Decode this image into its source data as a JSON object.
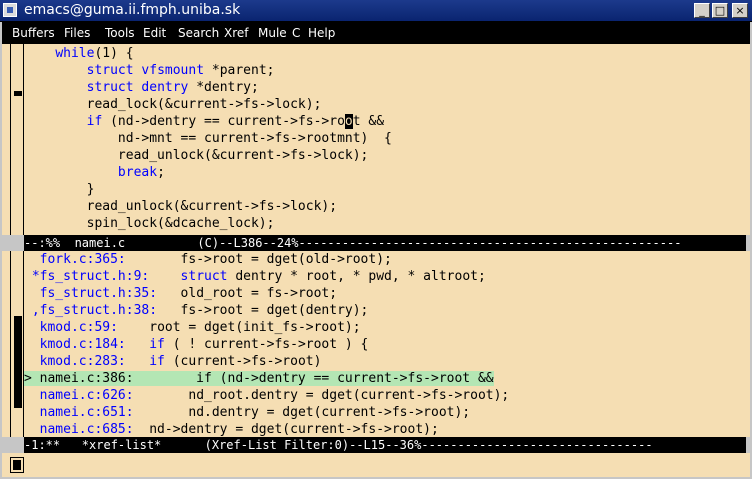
{
  "window": {
    "title": "emacs@guma.ii.fmph.uniba.sk",
    "minimize": "_",
    "maximize": "□",
    "close": "×"
  },
  "menu": [
    "Buffers",
    "Files",
    "Tools",
    "Edit",
    "Search",
    "Xref",
    "Mule",
    "C",
    "Help"
  ],
  "code_lines": [
    [
      {
        "t": "    "
      },
      {
        "t": "while",
        "c": "kw"
      },
      {
        "t": "(1) {"
      }
    ],
    [
      {
        "t": "        "
      },
      {
        "t": "struct",
        "c": "kw"
      },
      {
        "t": " "
      },
      {
        "t": "vfsmount",
        "c": "kw"
      },
      {
        "t": " *parent;"
      }
    ],
    [
      {
        "t": "        "
      },
      {
        "t": "struct",
        "c": "kw"
      },
      {
        "t": " "
      },
      {
        "t": "dentry",
        "c": "kw"
      },
      {
        "t": " *dentry;"
      }
    ],
    [
      {
        "t": "        read_lock(&current->fs->lock);"
      }
    ],
    [
      {
        "t": "        "
      },
      {
        "t": "if",
        "c": "kw"
      },
      {
        "t": " (nd->dentry == current->fs->ro"
      },
      {
        "t": "o",
        "c": "cursor"
      },
      {
        "t": "t &&"
      }
    ],
    [
      {
        "t": "            nd->mnt == current->fs->rootmnt)  {"
      }
    ],
    [
      {
        "t": "            read_unlock(&current->fs->lock);"
      }
    ],
    [
      {
        "t": "            "
      },
      {
        "t": "break",
        "c": "kw"
      },
      {
        "t": ";"
      }
    ],
    [
      {
        "t": "        }"
      }
    ],
    [
      {
        "t": "        read_unlock(&current->fs->lock);"
      }
    ],
    [
      {
        "t": "        spin_lock(&dcache_lock);"
      }
    ]
  ],
  "modeline_top": "--:%%  namei.c          (C)--L386--24%-----------------------------------------------------",
  "xref_lines": [
    [
      {
        "t": "  "
      },
      {
        "t": "fork.c:365:",
        "c": "fn"
      },
      {
        "t": "       fs->root = dget(old->root);"
      }
    ],
    [
      {
        "t": " "
      },
      {
        "t": "*fs_struct.h:9:",
        "c": "fn"
      },
      {
        "t": "    "
      },
      {
        "t": "struct",
        "c": "kw"
      },
      {
        "t": " dentry * root, * pwd, * altroot;"
      }
    ],
    [
      {
        "t": "  "
      },
      {
        "t": "fs_struct.h:35:",
        "c": "fn"
      },
      {
        "t": "   old_root = fs->root;"
      }
    ],
    [
      {
        "t": " "
      },
      {
        "t": ",fs_struct.h:38:",
        "c": "fn"
      },
      {
        "t": "   fs->root = dget(dentry);"
      }
    ],
    [
      {
        "t": "  "
      },
      {
        "t": "kmod.c:59:",
        "c": "fn"
      },
      {
        "t": "    root = dget(init_fs->root);"
      }
    ],
    [
      {
        "t": "  "
      },
      {
        "t": "kmod.c:184:",
        "c": "fn"
      },
      {
        "t": "   "
      },
      {
        "t": "if",
        "c": "kw"
      },
      {
        "t": " ( ! current->fs->root ) {"
      }
    ],
    [
      {
        "t": "  "
      },
      {
        "t": "kmod.c:283:",
        "c": "fn"
      },
      {
        "t": "   "
      },
      {
        "t": "if",
        "c": "kw"
      },
      {
        "t": " (current->fs->root)"
      }
    ],
    [
      {
        "t": "> namei.c:386:        if (nd->dentry == current->fs->root &&",
        "c": "hl"
      }
    ],
    [
      {
        "t": "  "
      },
      {
        "t": "namei.c:626:",
        "c": "fn"
      },
      {
        "t": "       nd_root.dentry = dget(current->fs->root);"
      }
    ],
    [
      {
        "t": "  "
      },
      {
        "t": "namei.c:651:",
        "c": "fn"
      },
      {
        "t": "       nd.dentry = dget(current->fs->root);"
      }
    ],
    [
      {
        "t": "  "
      },
      {
        "t": "namei.c:685:",
        "c": "fn"
      },
      {
        "t": "  nd->dentry = dget(current->fs->root);"
      }
    ]
  ],
  "modeline_bottom": "-1:**   *xref-list*      (Xref-List Filter:0)--L15--36%--------------------------------"
}
